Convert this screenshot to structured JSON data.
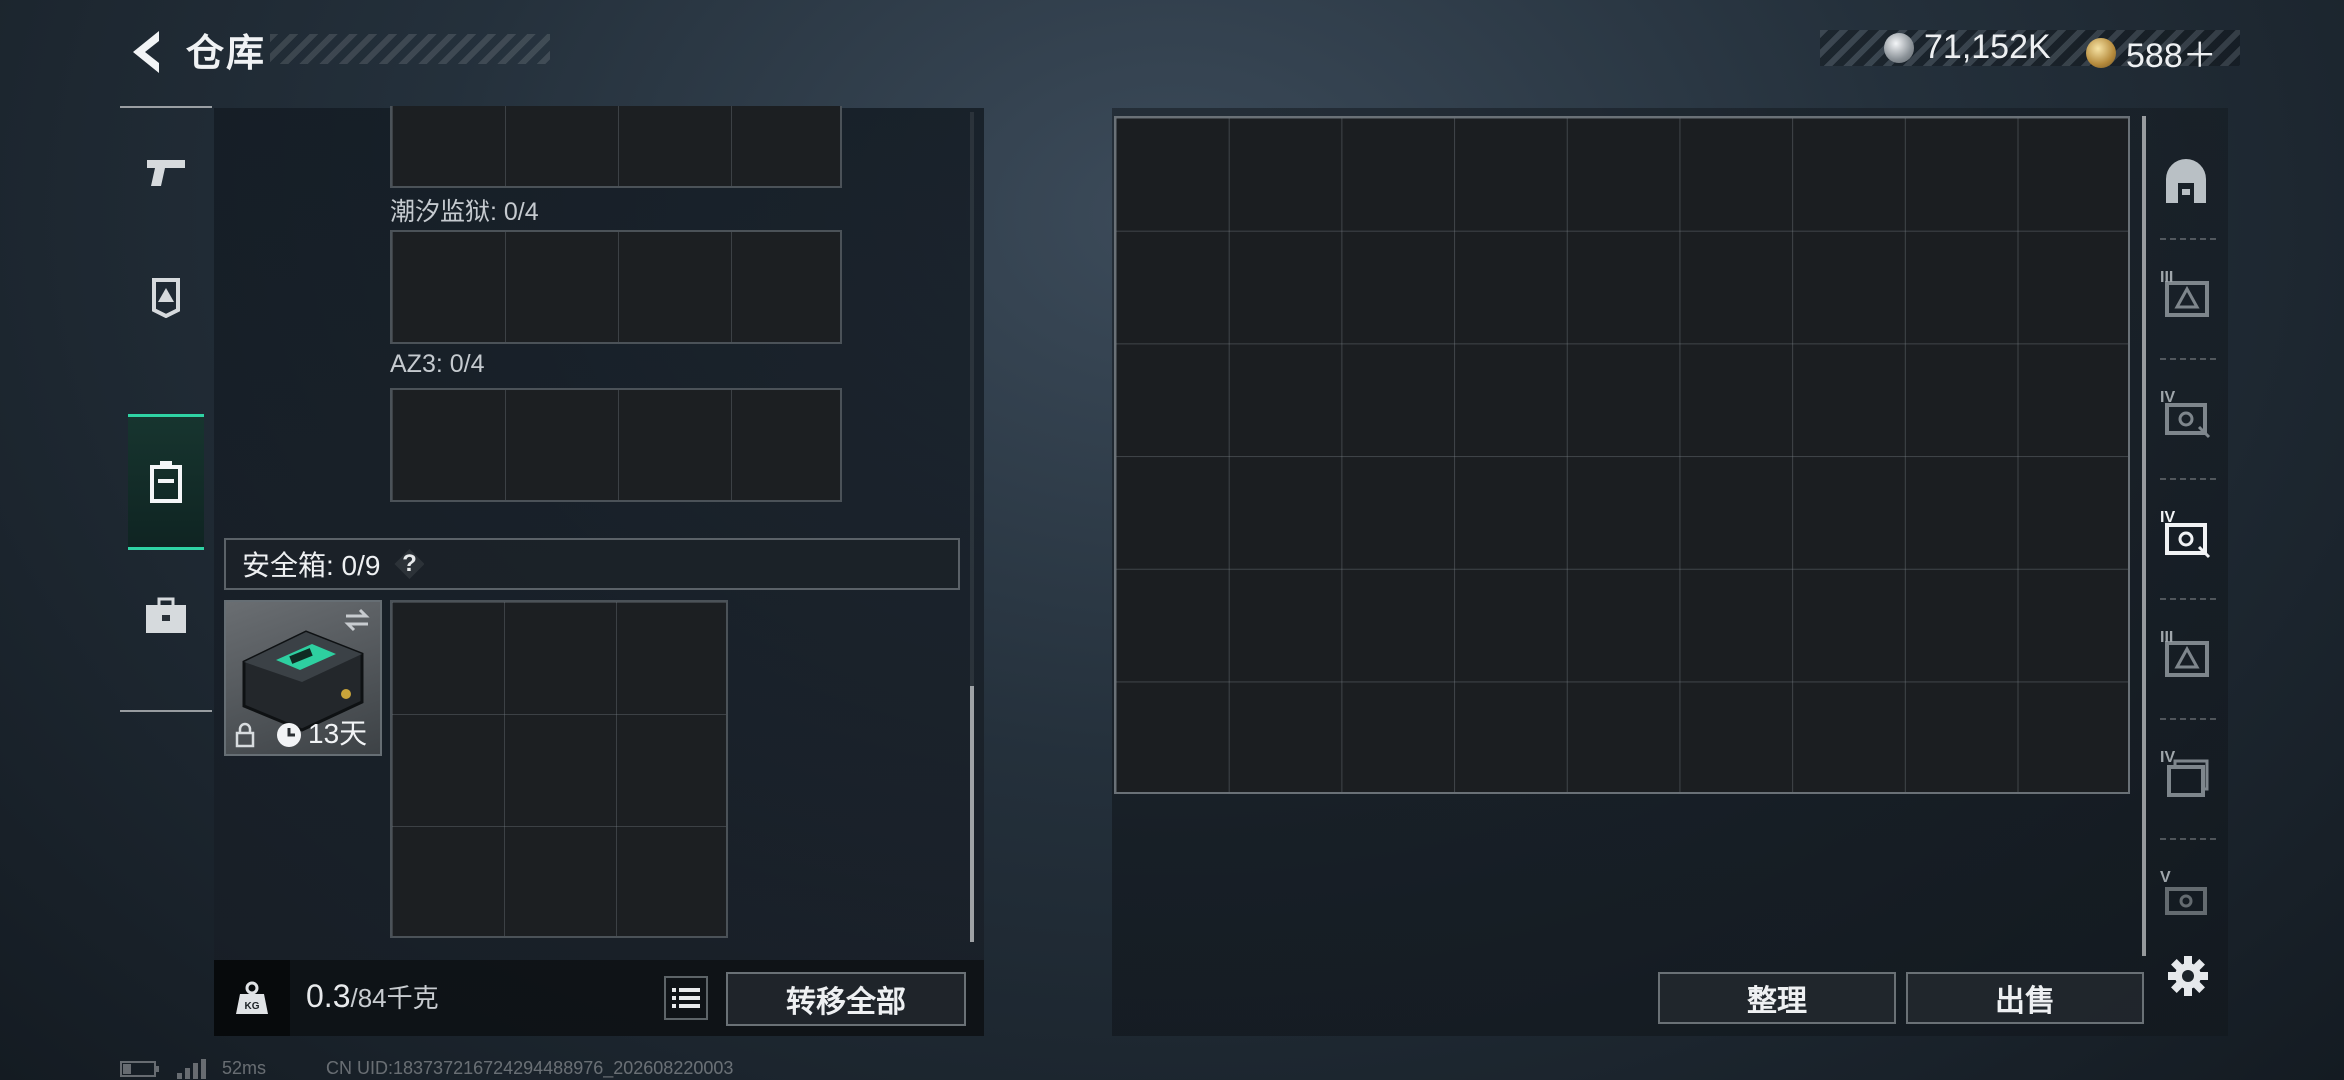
{
  "header": {
    "title": "仓库",
    "currencies": [
      {
        "icon": "silver-coin-icon",
        "value": "71,152K"
      },
      {
        "icon": "gold-coin-icon",
        "value": "588＋"
      }
    ]
  },
  "left_nav": {
    "items": [
      {
        "icon": "pistol-icon"
      },
      {
        "icon": "helmet-icon"
      },
      {
        "icon": "backpack-icon",
        "active": true
      },
      {
        "icon": "briefcase-icon"
      }
    ]
  },
  "loadout": {
    "slots": [
      {
        "label": ""
      },
      {
        "label": "潮汐监狱: 0/4"
      },
      {
        "label": "AZ3: 0/4"
      }
    ],
    "safebox": {
      "title": "安全箱: 0/9",
      "help": "?",
      "item": {
        "name": "safebox-case",
        "duration": "13天"
      }
    },
    "weight": {
      "current": "0.3",
      "max": "/84千克"
    },
    "transfer_all_label": "转移全部"
  },
  "storage": {
    "cols": 9,
    "rows": 6,
    "sort_label": "整理",
    "sell_label": "出售",
    "tabs": [
      {
        "icon": "vault-door-icon",
        "tier": ""
      },
      {
        "icon": "tier-iii-case-icon",
        "tier": "III"
      },
      {
        "icon": "tier-iv-case-icon",
        "tier": "IV"
      },
      {
        "icon": "tier-iv-case-selected-icon",
        "tier": "IV"
      },
      {
        "icon": "tier-iii-case-icon",
        "tier": "III"
      },
      {
        "icon": "tier-iv-box-icon",
        "tier": "IV"
      },
      {
        "icon": "tier-v-case-icon",
        "tier": "V"
      }
    ]
  },
  "footer": {
    "ping": "52ms",
    "uid": "CN UID:183737216724294488976_202608220003"
  },
  "colors": {
    "accent": "#2fd3a4",
    "panel": "#1c1f22"
  }
}
